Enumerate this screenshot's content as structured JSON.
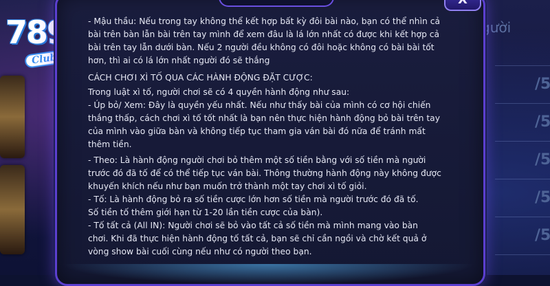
{
  "logo": {
    "number": "789",
    "club": "Club"
  },
  "side_table": {
    "header": "gười",
    "fraction": "/5"
  },
  "modal": {
    "close_label": "X",
    "paragraphs": [
      {
        "key": "mau_thau",
        "lines": [
          "- Mậu thầu: Nếu trong tay không thể kết hợp bất kỳ đôi bài nào, bạn có thể nhìn cả",
          "bài trên bàn lẫn bài trên tay mình để xem đâu là lá lớn nhất có được khi kết hợp cả",
          "bài trên tay lẫn dưới bàn. Nếu 2 người đều không có đôi hoặc không có bài bài tốt",
          "hơn, thì ai có lá lớn nhất người đó sẽ thắng"
        ]
      },
      {
        "key": "heading",
        "lines": [
          "CÁCH CHƠI XÌ TỐ QUA CÁC HÀNH ĐỘNG ĐẶT CƯỢC:"
        ]
      },
      {
        "key": "intro",
        "lines": [
          "Trong luật xì tố, người chơi sẽ có 4 quyền hành động như sau:"
        ]
      },
      {
        "key": "up_bo",
        "lines": [
          "- Úp bỏ/ Xem: Đây là quyền yếu nhất. Nếu như thấy bài của mình có cơ hội chiến",
          "thắng thấp, cách chơi xì tố tốt nhất là bạn nên thực hiện hành động bỏ bài trên tay",
          "của mình vào giữa bàn và không tiếp tục tham gia ván bài đó nữa để tránh mất",
          "thêm tiền."
        ]
      },
      {
        "key": "theo",
        "lines": [
          "- Theo: Là hành động người chơi bỏ thêm một số tiền bằng với số tiền mà người",
          "trước đó đã tố để có thể tiếp tục ván bài. Thông thường hành động này không được",
          "khuyến khích nếu như bạn muốn trở thành một tay chơi xì tố giỏi."
        ]
      },
      {
        "key": "to",
        "lines": [
          "- Tố:  Là hành động bỏ ra số tiền cược lớn hơn số tiền mà người trước đó đã tố.",
          "Số tiền tố thêm giới hạn từ 1-20 lần tiền cược của bàn)."
        ]
      },
      {
        "key": "to_tat_ca",
        "lines": [
          "- Tố tất cả (All IN): Người chơi sẽ bỏ vào tất cả số tiền mà mình mang vào bàn",
          "chơi. Khi đã thực hiện hành động tố tất cả, bạn sẽ chỉ cần ngồi và chờ kết quả ở",
          "vòng show bài cuối cùng nếu như có người theo bạn."
        ]
      }
    ]
  },
  "colors": {
    "modal_border": "#5b3fd0",
    "text": "#e6e8f4",
    "background": "#0d1230"
  }
}
